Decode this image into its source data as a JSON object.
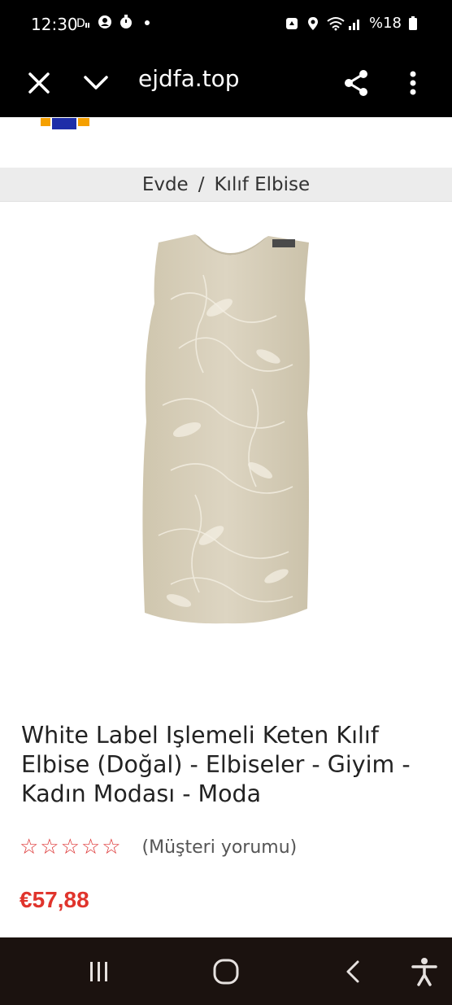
{
  "status_bar": {
    "time": "12:30",
    "battery_text": "%18",
    "icons_left": [
      "dolby-icon",
      "account-icon",
      "timer-icon",
      "dot-icon"
    ],
    "icons_right": [
      "recycle-icon",
      "location-icon",
      "wifi-icon",
      "signal-icon",
      "battery-icon"
    ]
  },
  "browser": {
    "url": "ejdfa.top",
    "close_icon": "close-icon",
    "dropdown_icon": "chevron-down-icon",
    "share_icon": "share-icon",
    "menu_icon": "more-vert-icon"
  },
  "breadcrumb": {
    "home": "Evde",
    "separator": "/",
    "current": "Kılıf Elbise"
  },
  "product": {
    "title": "White Label Işlemeli Keten Kılıf Elbise (Doğal) - Elbiseler - Giyim - Kadın Modası - Moda",
    "stars": "☆☆☆☆☆",
    "rating": 0,
    "review_text": "(Müşteri yorumu)",
    "price": "€57,88",
    "price_color": "#e0342c",
    "dress_color": "#d9d0bb"
  },
  "nav": {
    "recents_icon": "recents-icon",
    "home_icon": "home-icon",
    "back_icon": "back-icon",
    "accessibility_icon": "accessibility-icon"
  }
}
